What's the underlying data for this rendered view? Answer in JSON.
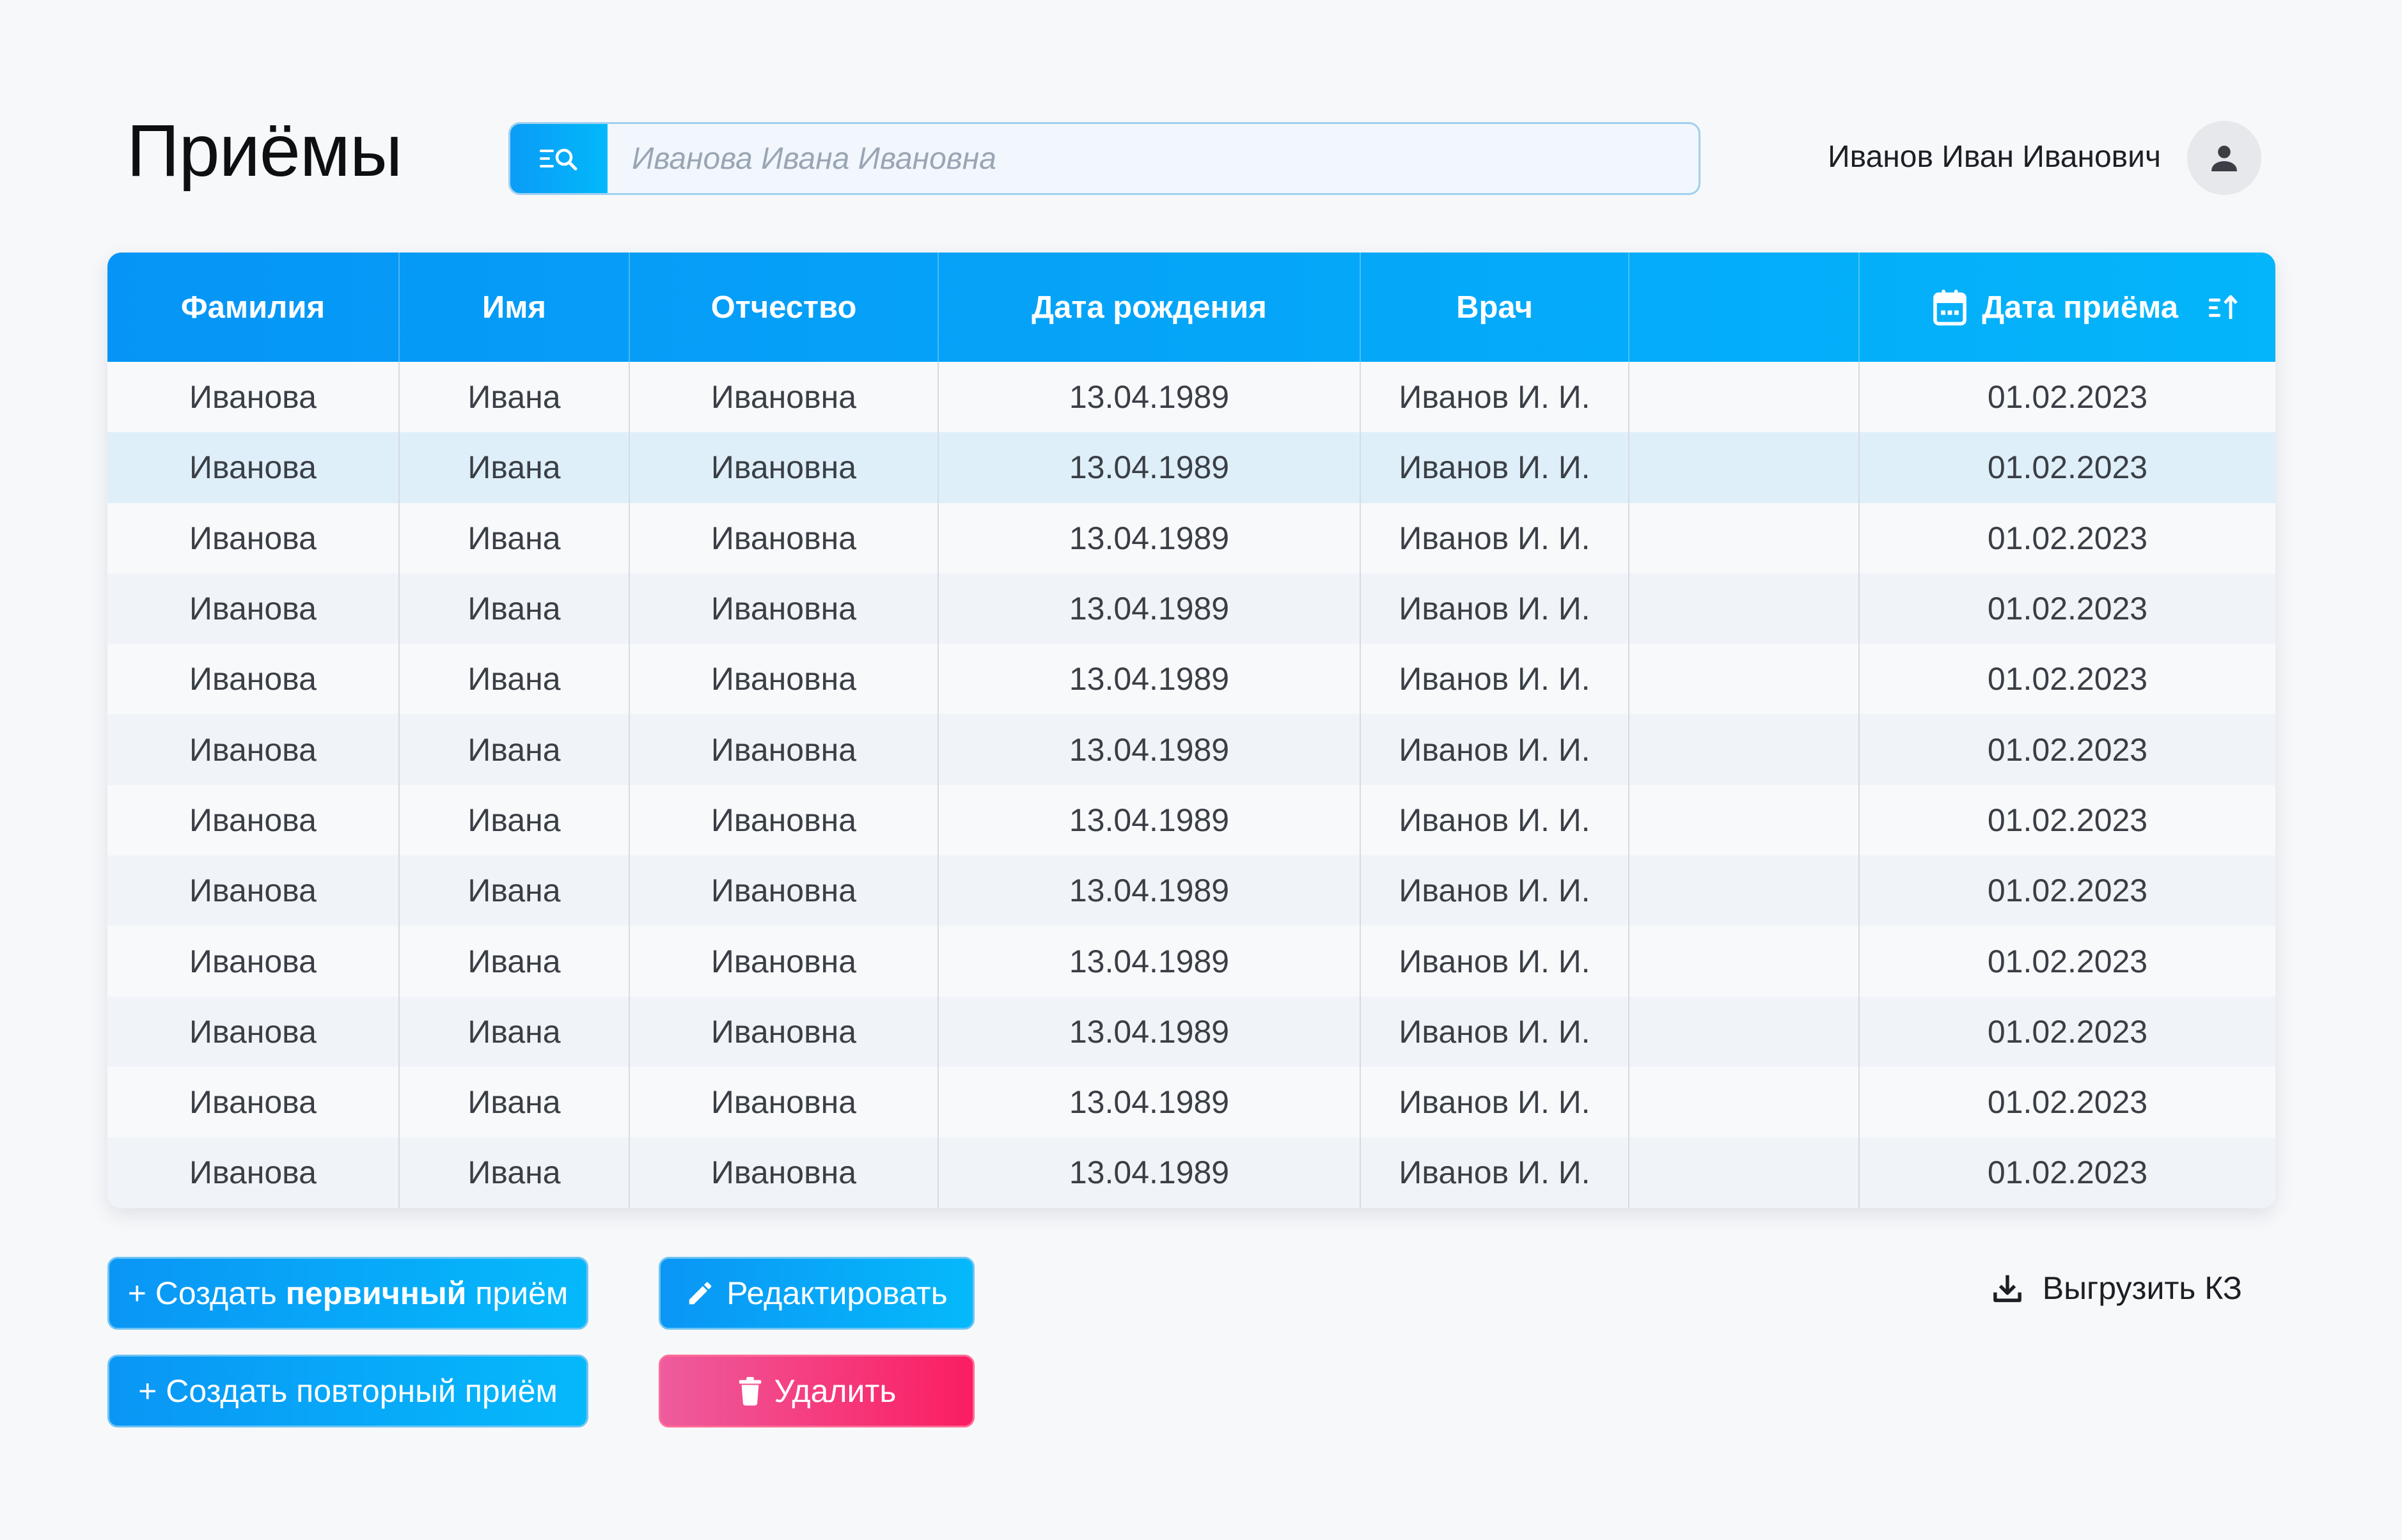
{
  "header": {
    "title": "Приёмы",
    "search_placeholder": "Иванова Ивана Ивановна",
    "user_name": "Иванов Иван Иванович"
  },
  "table": {
    "columns": [
      "Фамилия",
      "Имя",
      "Отчество",
      "Дата рождения",
      "Врач",
      "",
      "Дата приёма"
    ],
    "selected_row": 1,
    "rows": [
      [
        "Иванова",
        "Ивана",
        "Ивановна",
        "13.04.1989",
        "Иванов И. И.",
        "",
        "01.02.2023"
      ],
      [
        "Иванова",
        "Ивана",
        "Ивановна",
        "13.04.1989",
        "Иванов И. И.",
        "",
        "01.02.2023"
      ],
      [
        "Иванова",
        "Ивана",
        "Ивановна",
        "13.04.1989",
        "Иванов И. И.",
        "",
        "01.02.2023"
      ],
      [
        "Иванова",
        "Ивана",
        "Ивановна",
        "13.04.1989",
        "Иванов И. И.",
        "",
        "01.02.2023"
      ],
      [
        "Иванова",
        "Ивана",
        "Ивановна",
        "13.04.1989",
        "Иванов И. И.",
        "",
        "01.02.2023"
      ],
      [
        "Иванова",
        "Ивана",
        "Ивановна",
        "13.04.1989",
        "Иванов И. И.",
        "",
        "01.02.2023"
      ],
      [
        "Иванова",
        "Ивана",
        "Ивановна",
        "13.04.1989",
        "Иванов И. И.",
        "",
        "01.02.2023"
      ],
      [
        "Иванова",
        "Ивана",
        "Ивановна",
        "13.04.1989",
        "Иванов И. И.",
        "",
        "01.02.2023"
      ],
      [
        "Иванова",
        "Ивана",
        "Ивановна",
        "13.04.1989",
        "Иванов И. И.",
        "",
        "01.02.2023"
      ],
      [
        "Иванова",
        "Ивана",
        "Ивановна",
        "13.04.1989",
        "Иванов И. И.",
        "",
        "01.02.2023"
      ],
      [
        "Иванова",
        "Ивана",
        "Ивановна",
        "13.04.1989",
        "Иванов И. И.",
        "",
        "01.02.2023"
      ],
      [
        "Иванова",
        "Ивана",
        "Ивановна",
        "13.04.1989",
        "Иванов И. И.",
        "",
        "01.02.2023"
      ]
    ]
  },
  "actions": {
    "create_primary_prefix": "+ Создать ",
    "create_primary_bold": "первичный",
    "create_primary_suffix": " приём",
    "create_repeat": "+ Создать повторный приём",
    "edit": "Редактировать",
    "delete": "Удалить",
    "export": "Выгрузить КЗ"
  },
  "colors": {
    "accent_blue": "#0a9cf6",
    "accent_cyan": "#04b5fb",
    "danger_pink": "#fb1d62",
    "selected_row": "#dfeff9"
  }
}
